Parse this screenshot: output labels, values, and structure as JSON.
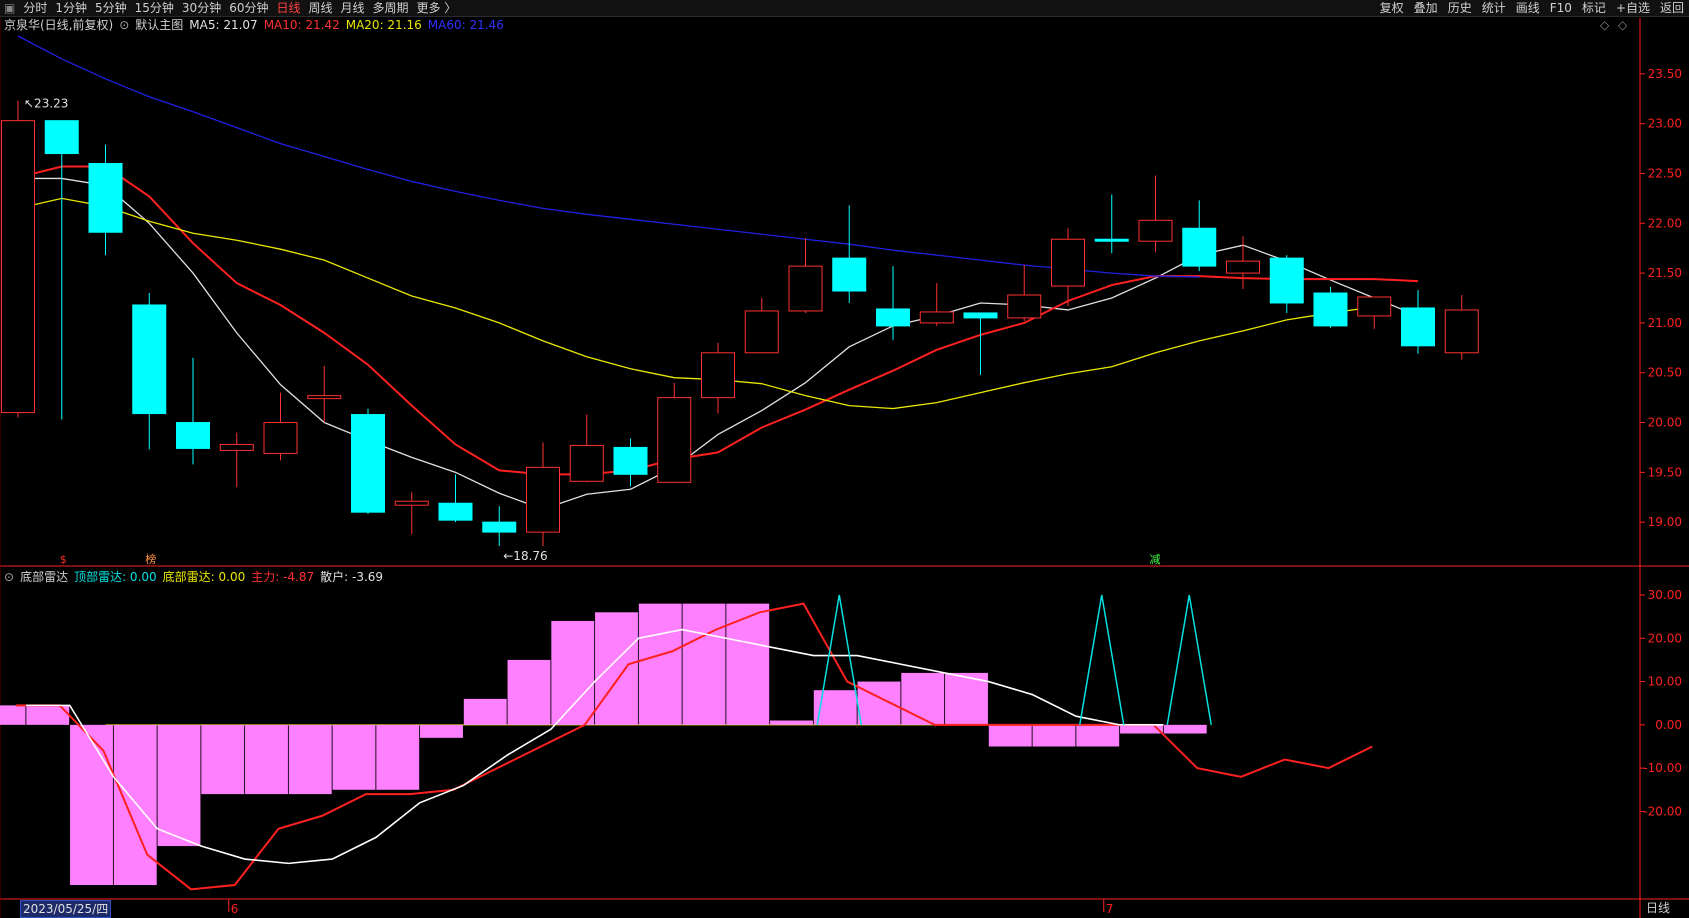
{
  "toolbar": {
    "periods": [
      "分时",
      "1分钟",
      "5分钟",
      "15分钟",
      "30分钟",
      "60分钟",
      "日线",
      "周线",
      "月线",
      "多周期",
      "更多 〉"
    ],
    "active_period": "日线",
    "right_tools": [
      "复权",
      "叠加",
      "历史",
      "统计",
      "画线",
      "F10",
      "标记",
      "+自选",
      "返回"
    ]
  },
  "top_info": {
    "stock": "京泉华(日线,前复权)",
    "main_chart": "默认主图",
    "ma5": "MA5: 21.07",
    "ma10": "MA10: 21.42",
    "ma20": "MA20: 21.16",
    "ma60": "MA60: 21.46"
  },
  "bottom_info": {
    "indicator": "底部雷达",
    "top_radar": "顶部雷达: 0.00",
    "bottom_radar": "底部雷达: 0.00",
    "main_force": "主力: -4.87",
    "retail": "散户: -3.69"
  },
  "status": {
    "date": "2023/05/25/四",
    "period_label": "日线"
  },
  "colors": {
    "up": "#ff3030",
    "down": "#00ffff",
    "ma5": "#e0e0e0",
    "ma10": "#ff2020",
    "ma20": "#e8e800",
    "ma60": "#2020e0",
    "retail": "#ff80ff",
    "axis": "#ff2020"
  },
  "chart_data": [
    {
      "type": "candlestick",
      "ylim": [
        18.6,
        23.9
      ],
      "y_ticks": [
        "19.00",
        "19.50",
        "20.00",
        "20.50",
        "21.00",
        "21.50",
        "22.00",
        "22.50",
        "23.00",
        "23.50"
      ],
      "x_ticks": [
        "6",
        "7"
      ],
      "annotations": {
        "high": "23.23",
        "low": "18.76",
        "markers": [
          "$",
          "榜",
          "减"
        ]
      },
      "candles": [
        {
          "o": 20.1,
          "h": 23.23,
          "l": 20.05,
          "c": 23.03
        },
        {
          "o": 23.03,
          "h": 23.03,
          "l": 20.03,
          "c": 22.7
        },
        {
          "o": 22.6,
          "h": 22.79,
          "l": 21.68,
          "c": 21.91
        },
        {
          "o": 21.18,
          "h": 21.3,
          "l": 19.73,
          "c": 20.09
        },
        {
          "o": 20.0,
          "h": 20.65,
          "l": 19.58,
          "c": 19.74
        },
        {
          "o": 19.72,
          "h": 19.9,
          "l": 19.35,
          "c": 19.78
        },
        {
          "o": 19.69,
          "h": 20.3,
          "l": 19.62,
          "c": 20.0
        },
        {
          "o": 20.24,
          "h": 20.57,
          "l": 20.0,
          "c": 20.27
        },
        {
          "o": 20.08,
          "h": 20.14,
          "l": 19.08,
          "c": 19.1
        },
        {
          "o": 19.17,
          "h": 19.3,
          "l": 18.88,
          "c": 19.21
        },
        {
          "o": 19.19,
          "h": 19.48,
          "l": 19.0,
          "c": 19.02
        },
        {
          "o": 19.0,
          "h": 19.16,
          "l": 18.76,
          "c": 18.9
        },
        {
          "o": 18.9,
          "h": 19.8,
          "l": 18.76,
          "c": 19.55
        },
        {
          "o": 19.41,
          "h": 20.08,
          "l": 19.4,
          "c": 19.77
        },
        {
          "o": 19.75,
          "h": 19.84,
          "l": 19.36,
          "c": 19.48
        },
        {
          "o": 19.4,
          "h": 20.4,
          "l": 19.4,
          "c": 20.25
        },
        {
          "o": 20.25,
          "h": 20.8,
          "l": 20.09,
          "c": 20.7
        },
        {
          "o": 20.7,
          "h": 21.25,
          "l": 20.7,
          "c": 21.12
        },
        {
          "o": 21.12,
          "h": 21.85,
          "l": 21.1,
          "c": 21.57
        },
        {
          "o": 21.65,
          "h": 22.18,
          "l": 21.2,
          "c": 21.32
        },
        {
          "o": 21.14,
          "h": 21.57,
          "l": 20.83,
          "c": 20.97
        },
        {
          "o": 21.0,
          "h": 21.4,
          "l": 20.97,
          "c": 21.11
        },
        {
          "o": 21.1,
          "h": 21.1,
          "l": 20.48,
          "c": 21.05
        },
        {
          "o": 21.05,
          "h": 21.58,
          "l": 21.02,
          "c": 21.28
        },
        {
          "o": 21.37,
          "h": 21.95,
          "l": 21.17,
          "c": 21.84
        },
        {
          "o": 21.84,
          "h": 22.29,
          "l": 21.7,
          "c": 21.83
        },
        {
          "o": 21.82,
          "h": 22.48,
          "l": 21.71,
          "c": 22.03
        },
        {
          "o": 21.95,
          "h": 22.23,
          "l": 21.52,
          "c": 21.57
        },
        {
          "o": 21.5,
          "h": 21.87,
          "l": 21.34,
          "c": 21.62
        },
        {
          "o": 21.65,
          "h": 21.68,
          "l": 21.1,
          "c": 21.2
        },
        {
          "o": 21.3,
          "h": 21.36,
          "l": 20.95,
          "c": 20.97
        },
        {
          "o": 21.07,
          "h": 21.26,
          "l": 20.94,
          "c": 21.26
        },
        {
          "o": 21.15,
          "h": 21.33,
          "l": 20.69,
          "c": 20.77
        },
        {
          "o": 20.7,
          "h": 21.28,
          "l": 20.63,
          "c": 21.13
        }
      ],
      "ma_series": [
        {
          "name": "MA5",
          "color": "#e0e0e0",
          "values": [
            22.45,
            22.45,
            22.38,
            22.0,
            21.5,
            20.9,
            20.38,
            20.0,
            19.82,
            19.65,
            19.5,
            19.29,
            19.13,
            19.28,
            19.33,
            19.55,
            19.88,
            20.12,
            20.4,
            20.76,
            20.97,
            21.07,
            21.2,
            21.18,
            21.13,
            21.25,
            21.45,
            21.68,
            21.78,
            21.62,
            21.43,
            21.25,
            21.07
          ]
        },
        {
          "name": "MA10",
          "color": "#ff2020",
          "values": [
            22.46,
            22.57,
            22.57,
            22.27,
            21.8,
            21.4,
            21.18,
            20.9,
            20.58,
            20.17,
            19.78,
            19.52,
            19.48,
            19.48,
            19.52,
            19.63,
            19.7,
            19.95,
            20.13,
            20.33,
            20.52,
            20.73,
            20.88,
            21.0,
            21.22,
            21.38,
            21.47,
            21.47,
            21.45,
            21.44,
            21.44,
            21.44,
            21.42
          ]
        },
        {
          "name": "MA20",
          "color": "#e8e800",
          "values": [
            22.15,
            22.25,
            22.17,
            22.02,
            21.9,
            21.83,
            21.74,
            21.63,
            21.45,
            21.27,
            21.15,
            21.0,
            20.82,
            20.66,
            20.54,
            20.45,
            20.43,
            20.39,
            20.27,
            20.17,
            20.14,
            20.2,
            20.3,
            20.4,
            20.49,
            20.56,
            20.7,
            20.82,
            20.92,
            21.03,
            21.1,
            21.16
          ]
        },
        {
          "name": "MA60",
          "color": "#2020e0",
          "values": [
            23.88,
            23.65,
            23.45,
            23.27,
            23.12,
            22.96,
            22.8,
            22.67,
            22.54,
            22.42,
            22.32,
            22.23,
            22.15,
            22.09,
            22.04,
            21.99,
            21.94,
            21.89,
            21.84,
            21.79,
            21.73,
            21.68,
            21.63,
            21.58,
            21.54,
            21.5,
            21.47,
            21.46
          ]
        }
      ]
    },
    {
      "type": "indicator",
      "ylim": [
        -40,
        33
      ],
      "y_ticks": [
        "30.00",
        "20.00",
        "10.00",
        "0.00",
        "-10.00",
        "-20.00"
      ],
      "retail_bars": [
        4.5,
        4.5,
        -37,
        -37,
        -28,
        -16,
        -16,
        -16,
        -15,
        -15,
        -3,
        6,
        15,
        24,
        26,
        28,
        28,
        28,
        1,
        8,
        10,
        12,
        12,
        -5,
        -5,
        -5,
        -2,
        -2
      ],
      "main_force": [
        4.5,
        4.5,
        -6,
        -30,
        -38,
        -37,
        -24,
        -21,
        -16,
        -16,
        -15,
        -10,
        -5,
        0,
        14,
        17,
        22,
        26,
        28,
        10,
        5,
        0,
        0,
        0,
        0,
        0,
        0,
        -10,
        -12,
        -8,
        -10,
        -5
      ],
      "white_line": [
        4.5,
        4.5,
        -12,
        -24,
        -28,
        -31,
        -32,
        -31,
        -26,
        -18,
        -14,
        -7,
        -1,
        10,
        20,
        22,
        20,
        18,
        16,
        16,
        14,
        12,
        10,
        7,
        2,
        0,
        0
      ],
      "radar_spikes": [
        30,
        30,
        30
      ]
    }
  ]
}
